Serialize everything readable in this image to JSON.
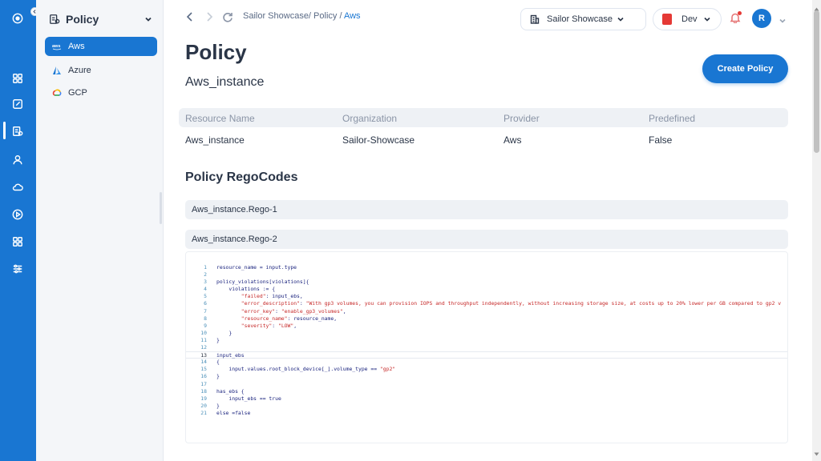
{
  "rail": {
    "icons": [
      "target-icon",
      "dashboard-icon",
      "edit-icon",
      "policy-icon",
      "user-icon",
      "cloud-icon",
      "play-icon",
      "apps-icon",
      "sliders-icon"
    ]
  },
  "sidebar": {
    "title": "Policy",
    "items": [
      {
        "label": "Aws",
        "icon": "aws-icon",
        "active": true
      },
      {
        "label": "Azure",
        "icon": "azure-icon",
        "active": false
      },
      {
        "label": "GCP",
        "icon": "gcp-icon",
        "active": false
      }
    ]
  },
  "topbar": {
    "breadcrumb_prefix": "Sailor Showcase/ Policy / ",
    "breadcrumb_current": "Aws",
    "org": "Sailor Showcase",
    "env": "Dev",
    "avatar": "R"
  },
  "main": {
    "title": "Policy",
    "subtitle": "Aws_instance",
    "create_button": "Create Policy",
    "table": {
      "headers": [
        "Resource Name",
        "Organization",
        "Provider",
        "Predefined"
      ],
      "row": [
        "Aws_instance",
        "Sailor-Showcase",
        "Aws",
        "False"
      ]
    },
    "section_title": "Policy RegoCodes",
    "accordions": [
      "Aws_instance.Rego-1",
      "Aws_instance.Rego-2"
    ]
  },
  "code": {
    "current_line": 13,
    "lines": [
      "resource_name = input.type",
      "",
      "policy_violations[violations]{",
      "    violations := {",
      "        \"failed\": input_ebs,",
      "        \"error_description\": \"With gp3 volumes, you can provision IOPS and throughput independently, without increasing storage size, at costs up to 20% lower per GB compared to gp2 v",
      "        \"error_key\": \"enable_gp3_volumes\",",
      "        \"resource_name\": resource_name,",
      "        \"severity\": \"LOW\",",
      "    }",
      "}",
      "",
      "input_ebs",
      "{",
      "    input.values.root_block_device[_].volume_type == \"gp2\"",
      "}",
      "",
      "has_ebs {",
      "    input_ebs == true",
      "}",
      "else =false"
    ]
  },
  "colors": {
    "primary": "#1976d2",
    "env_badge": "#e53935"
  }
}
